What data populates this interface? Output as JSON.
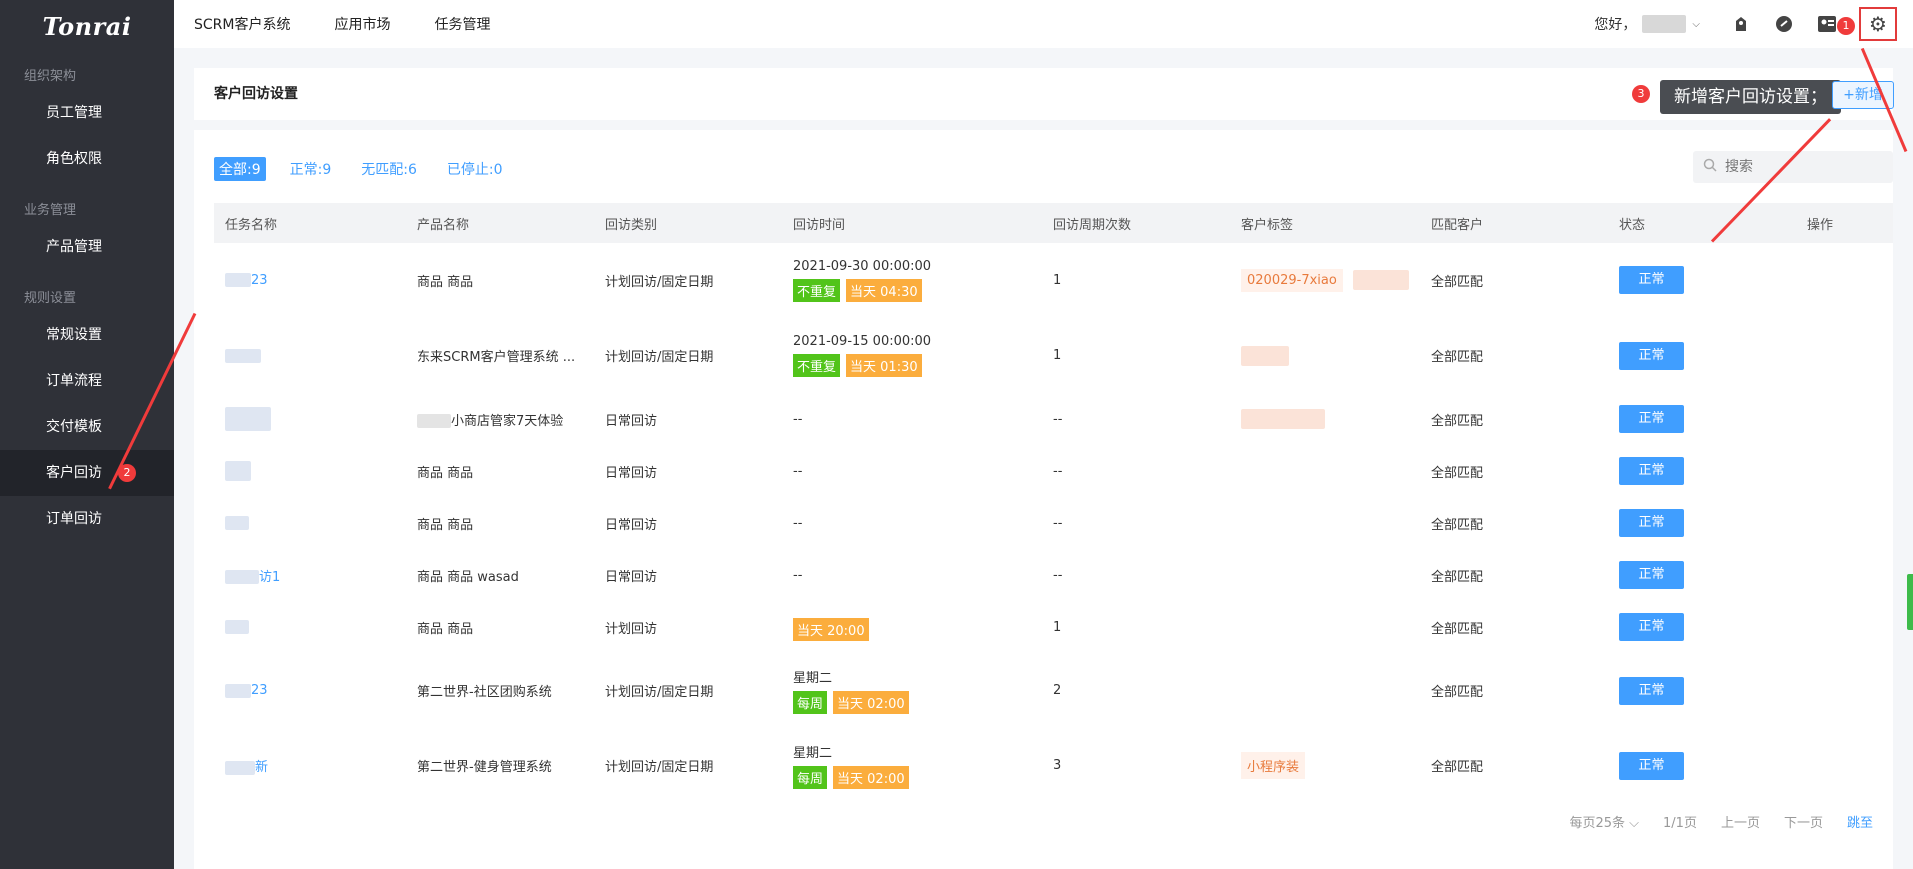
{
  "brand": {
    "logo": "Tonrai"
  },
  "topnav": [
    "SCRM客户系统",
    "应用市场",
    "任务管理"
  ],
  "user": {
    "greeting": "您好，"
  },
  "sidebar": {
    "groups": [
      {
        "title": "组织架构",
        "items": [
          "员工管理",
          "角色权限"
        ]
      },
      {
        "title": "业务管理",
        "items": [
          "产品管理"
        ]
      },
      {
        "title": "规则设置",
        "items": [
          "常规设置",
          "订单流程",
          "交付模板",
          "客户回访",
          "订单回访"
        ]
      }
    ],
    "active": "客户回访"
  },
  "annotations": {
    "badge1": "1",
    "badge2": "2",
    "badge3": "3",
    "tooltip": "新增客户回访设置；"
  },
  "page": {
    "title": "客户回访设置",
    "add_button": "+新增"
  },
  "filters": [
    {
      "label": "全部:9",
      "active": true
    },
    {
      "label": "正常:9",
      "active": false
    },
    {
      "label": "无匹配:6",
      "active": false
    },
    {
      "label": "已停止:0",
      "active": false
    }
  ],
  "search": {
    "placeholder": "搜索"
  },
  "table": {
    "headers": [
      "任务名称",
      "产品名称",
      "回访类别",
      "回访时间",
      "回访周期次数",
      "客户标签",
      "匹配客户",
      "状态",
      "操作"
    ],
    "rows": [
      {
        "name": "23",
        "product": "商品 商品",
        "category": "计划回访/固定日期",
        "time": "2021-09-30 00:00:00",
        "tags": [
          "不重复",
          "当天 04:30"
        ],
        "count": "1",
        "ctag": "020029-7xiao",
        "match": "全部匹配",
        "status": "正常"
      },
      {
        "name": "",
        "product": "东来SCRM客户管理系统 ...",
        "category": "计划回访/固定日期",
        "time": "2021-09-15 00:00:00",
        "tags": [
          "不重复",
          "当天 01:30"
        ],
        "count": "1",
        "ctag": "",
        "match": "全部匹配",
        "status": "正常"
      },
      {
        "name": "",
        "product": "小商店管家7天体验",
        "category": "日常回访",
        "time": "--",
        "tags": [],
        "count": "--",
        "ctag": "",
        "match": "全部匹配",
        "status": "正常"
      },
      {
        "name": "",
        "product": "商品 商品",
        "category": "日常回访",
        "time": "--",
        "tags": [],
        "count": "--",
        "ctag": "",
        "match": "全部匹配",
        "status": "正常"
      },
      {
        "name": "",
        "product": "商品 商品",
        "category": "日常回访",
        "time": "--",
        "tags": [],
        "count": "--",
        "ctag": "",
        "match": "全部匹配",
        "status": "正常"
      },
      {
        "name": "访1",
        "product": "商品 商品 wasad",
        "category": "日常回访",
        "time": "--",
        "tags": [],
        "count": "--",
        "ctag": "",
        "match": "全部匹配",
        "status": "正常"
      },
      {
        "name": "",
        "product": "商品 商品",
        "category": "计划回访",
        "time": "",
        "tags": [
          "当天 20:00"
        ],
        "count": "1",
        "ctag": "",
        "match": "全部匹配",
        "status": "正常"
      },
      {
        "name": "23",
        "product": "第二世界-社区团购系统",
        "category": "计划回访/固定日期",
        "time": "星期二",
        "tags": [
          "每周",
          "当天 02:00"
        ],
        "count": "2",
        "ctag": "",
        "match": "全部匹配",
        "status": "正常"
      },
      {
        "name": "新",
        "product": "第二世界-健身管理系统",
        "category": "计划回访/固定日期",
        "time": "星期二",
        "tags": [
          "每周",
          "当天 02:00"
        ],
        "count": "3",
        "ctag": "小程序装",
        "match": "全部匹配",
        "status": "正常"
      }
    ]
  },
  "pager": {
    "page_size": "每页25条",
    "pages": "1/1页",
    "prev": "上一页",
    "next": "下一页",
    "jump": "跳至"
  },
  "colors": {
    "primary": "#409eff",
    "sidebar": "#2f3138",
    "green": "#52c41a",
    "orange": "#fbad3d",
    "annotation": "#f03b3b"
  }
}
